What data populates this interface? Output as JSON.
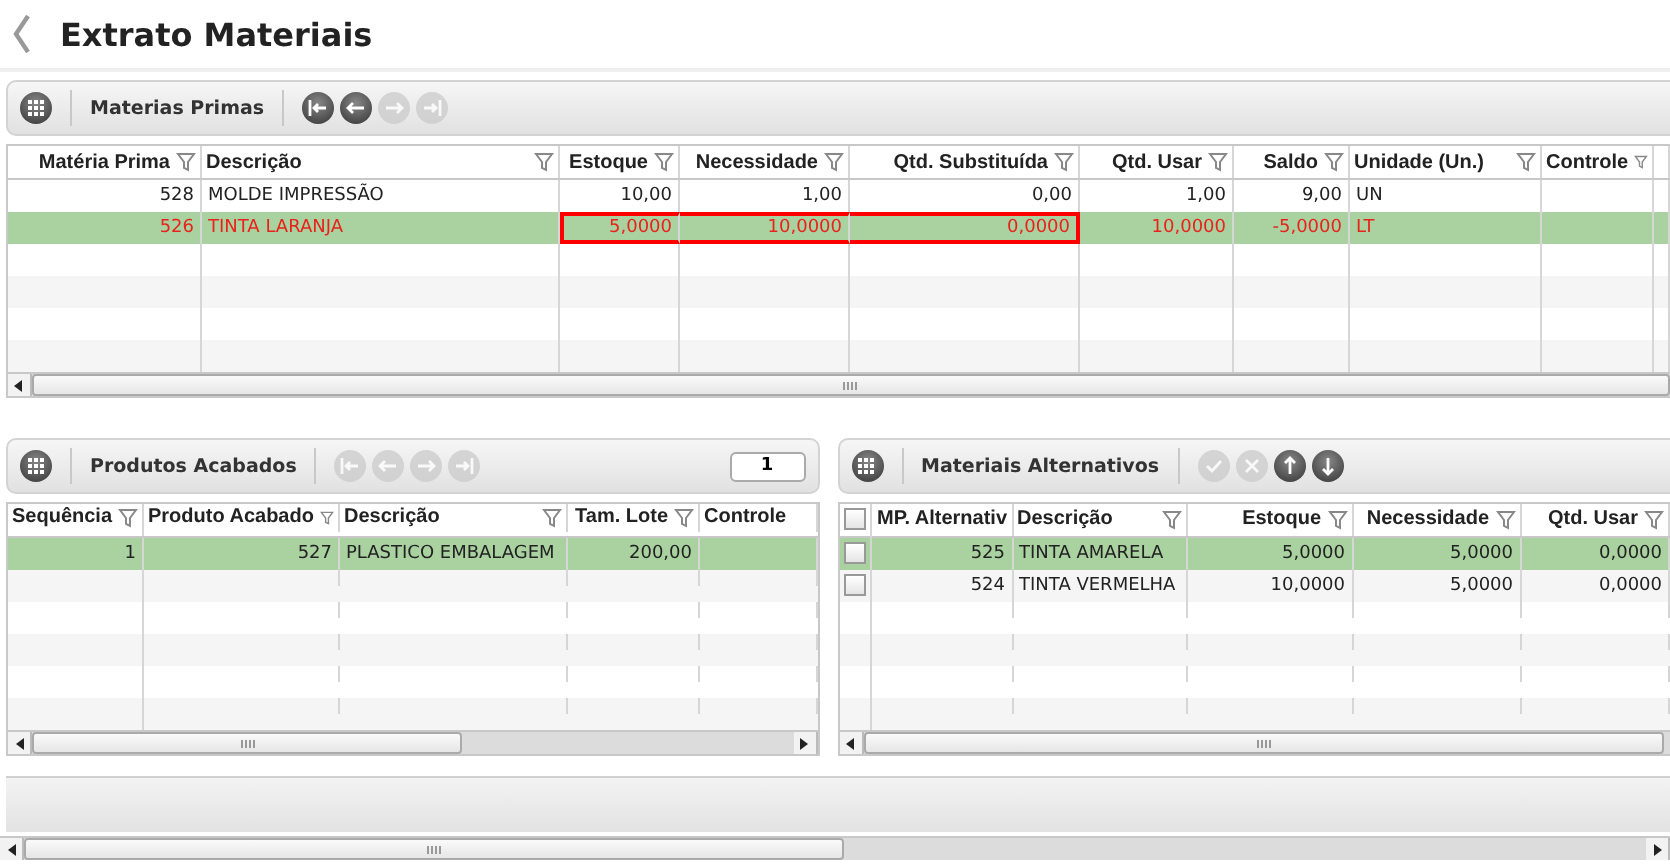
{
  "title": "Extrato Materiais",
  "materias_primas": {
    "toolbar": {
      "label": "Materias Primas",
      "buttons": [
        {
          "kind": "first",
          "disabled": false
        },
        {
          "kind": "prev",
          "disabled": false
        },
        {
          "kind": "next",
          "disabled": true
        },
        {
          "kind": "last",
          "disabled": true
        }
      ]
    },
    "columns": [
      {
        "label": "Matéria Prima",
        "numeric": true,
        "filter": true
      },
      {
        "label": "Descrição",
        "numeric": false,
        "filter": true
      },
      {
        "label": "Estoque",
        "numeric": true,
        "filter": true
      },
      {
        "label": "Necessidade",
        "numeric": true,
        "filter": true
      },
      {
        "label": "Qtd. Substituída",
        "numeric": true,
        "filter": true
      },
      {
        "label": "Qtd. Usar",
        "numeric": true,
        "filter": true
      },
      {
        "label": "Saldo",
        "numeric": true,
        "filter": true
      },
      {
        "label": "Unidade (Un.)",
        "numeric": false,
        "filter": true
      },
      {
        "label": "Controle",
        "numeric": false,
        "filter": true
      }
    ],
    "rows": [
      {
        "selected": false,
        "alert": false,
        "cells": [
          {
            "text": "528",
            "outlined": false
          },
          {
            "text": "MOLDE IMPRESSÃO",
            "outlined": false
          },
          {
            "text": "10,00",
            "outlined": false
          },
          {
            "text": "1,00",
            "outlined": false
          },
          {
            "text": "0,00",
            "outlined": false
          },
          {
            "text": "1,00",
            "outlined": false
          },
          {
            "text": "9,00",
            "outlined": false
          },
          {
            "text": "UN",
            "outlined": false
          },
          {
            "text": "",
            "outlined": false
          }
        ]
      },
      {
        "selected": true,
        "alert": true,
        "cells": [
          {
            "text": "526",
            "outlined": false
          },
          {
            "text": "TINTA LARANJA",
            "outlined": false
          },
          {
            "text": "5,0000",
            "outlined": true
          },
          {
            "text": "10,0000",
            "outlined": true
          },
          {
            "text": "0,0000",
            "outlined": true
          },
          {
            "text": "10,0000",
            "outlined": false
          },
          {
            "text": "-5,0000",
            "outlined": false
          },
          {
            "text": "LT",
            "outlined": false
          },
          {
            "text": "",
            "outlined": false
          }
        ]
      }
    ]
  },
  "produtos_acabados": {
    "toolbar": {
      "label": "Produtos Acabados",
      "buttons": [
        {
          "kind": "first",
          "disabled": true
        },
        {
          "kind": "prev",
          "disabled": true
        },
        {
          "kind": "next",
          "disabled": true
        },
        {
          "kind": "last",
          "disabled": true
        }
      ],
      "page": "1"
    },
    "columns": [
      {
        "label": "Sequência",
        "numeric": true,
        "filter": true
      },
      {
        "label": "Produto Acabado",
        "numeric": true,
        "filter": true
      },
      {
        "label": "Descrição",
        "numeric": false,
        "filter": true
      },
      {
        "label": "Tam. Lote",
        "numeric": true,
        "filter": true
      },
      {
        "label": "Controle",
        "numeric": false,
        "filter": false
      }
    ],
    "rows": [
      {
        "selected": true,
        "cells": [
          "1",
          "527",
          "PLASTICO EMBALAGEM",
          "200,00",
          ""
        ]
      }
    ]
  },
  "materiais_alternativos": {
    "toolbar": {
      "label": "Materiais Alternativos",
      "buttons": [
        {
          "kind": "confirm",
          "disabled": true
        },
        {
          "kind": "cancel",
          "disabled": true
        },
        {
          "kind": "up",
          "disabled": false
        },
        {
          "kind": "down",
          "disabled": false
        }
      ]
    },
    "select_all": {
      "checked": false
    },
    "columns": [
      {
        "label": "MP. Alternativ",
        "numeric": true,
        "filter": false
      },
      {
        "label": "Descrição",
        "numeric": false,
        "filter": true
      },
      {
        "label": "Estoque",
        "numeric": true,
        "filter": true
      },
      {
        "label": "Necessidade",
        "numeric": true,
        "filter": true
      },
      {
        "label": "Qtd. Usar",
        "numeric": true,
        "filter": true
      }
    ],
    "rows": [
      {
        "selected": true,
        "checked": false,
        "cells": [
          "525",
          "TINTA AMARELA",
          "5,0000",
          "5,0000",
          "0,0000"
        ]
      },
      {
        "selected": false,
        "checked": false,
        "cells": [
          "524",
          "TINTA VERMELHA",
          "10,0000",
          "5,0000",
          "0,0000"
        ]
      }
    ]
  }
}
